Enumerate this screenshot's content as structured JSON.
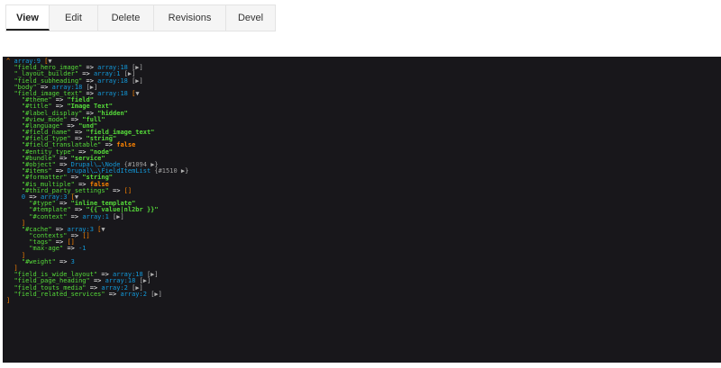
{
  "tabs": {
    "view": "View",
    "edit": "Edit",
    "delete": "Delete",
    "revisions": "Revisions",
    "devel": "Devel"
  },
  "dump": {
    "root": {
      "prefix": "^ ",
      "type": "array:9",
      "open": "[",
      "toggle": "▼"
    },
    "field_hero_image": {
      "key": "\"field_hero_image\"",
      "type": "array:18",
      "toggle": "[▶]"
    },
    "layout_builder": {
      "key": "\"_layout_builder\"",
      "type": "array:1",
      "toggle": "[▶]"
    },
    "field_subheading": {
      "key": "\"field_subheading\"",
      "type": "array:18",
      "toggle": "[▶]"
    },
    "body": {
      "key": "\"body\"",
      "type": "array:18",
      "toggle": "[▶]"
    },
    "field_image_text": {
      "key": "\"field_image_text\"",
      "type": "array:18",
      "open": "[",
      "toggle": "▼"
    },
    "theme": {
      "key": "\"#theme\"",
      "value": "\"field\""
    },
    "title": {
      "key": "\"#title\"",
      "value": "\"Image Text\""
    },
    "label_display": {
      "key": "\"#label_display\"",
      "value": "\"hidden\""
    },
    "view_mode": {
      "key": "\"#view_mode\"",
      "value": "\"full\""
    },
    "language": {
      "key": "\"#language\"",
      "value": "\"und\""
    },
    "field_name": {
      "key": "\"#field_name\"",
      "value": "\"field_image_text\""
    },
    "field_type": {
      "key": "\"#field_type\"",
      "value": "\"string\""
    },
    "field_translatable": {
      "key": "\"#field_translatable\"",
      "value": "false"
    },
    "entity_type": {
      "key": "\"#entity_type\"",
      "value": "\"node\""
    },
    "bundle": {
      "key": "\"#bundle\"",
      "value": "\"service\""
    },
    "object": {
      "key": "\"#object\"",
      "class": "Drupal\\…\\Node",
      "ref": "{#1094",
      "toggle": "▶}"
    },
    "items": {
      "key": "\"#items\"",
      "class": "Drupal\\…\\FieldItemList",
      "ref": "{#1510",
      "toggle": "▶}"
    },
    "formatter": {
      "key": "\"#formatter\"",
      "value": "\"string\""
    },
    "is_multiple": {
      "key": "\"#is_multiple\"",
      "value": "false"
    },
    "third_party_settings": {
      "key": "\"#third_party_settings\"",
      "value": "[]"
    },
    "zero": {
      "key": "0",
      "type": "array:3",
      "open": "[",
      "toggle": "▼"
    },
    "type": {
      "key": "\"#type\"",
      "value": "\"inline_template\""
    },
    "template": {
      "key": "\"#template\"",
      "value": "\"{{ value|nl2br }}\""
    },
    "context": {
      "key": "\"#context\"",
      "type": "array:1",
      "toggle": "[▶]"
    },
    "cache": {
      "key": "\"#cache\"",
      "type": "array:3",
      "open": "[",
      "toggle": "▼"
    },
    "contexts": {
      "key": "\"contexts\"",
      "value": "[]"
    },
    "tags": {
      "key": "\"tags\"",
      "value": "[]"
    },
    "max_age": {
      "key": "\"max-age\"",
      "value": "-1"
    },
    "weight": {
      "key": "\"#weight\"",
      "value": "3"
    },
    "field_is_wide_layout": {
      "key": "\"field_is_wide_layout\"",
      "type": "array:18",
      "toggle": "[▶]"
    },
    "field_page_heading": {
      "key": "\"field_page_heading\"",
      "type": "array:18",
      "toggle": "[▶]"
    },
    "field_touts_media": {
      "key": "\"field_touts_media\"",
      "type": "array:2",
      "toggle": "[▶]"
    },
    "field_related_services": {
      "key": "\"field_related_services\"",
      "type": "array:2",
      "toggle": "[▶]"
    },
    "arrow": " => ",
    "close": "]"
  }
}
